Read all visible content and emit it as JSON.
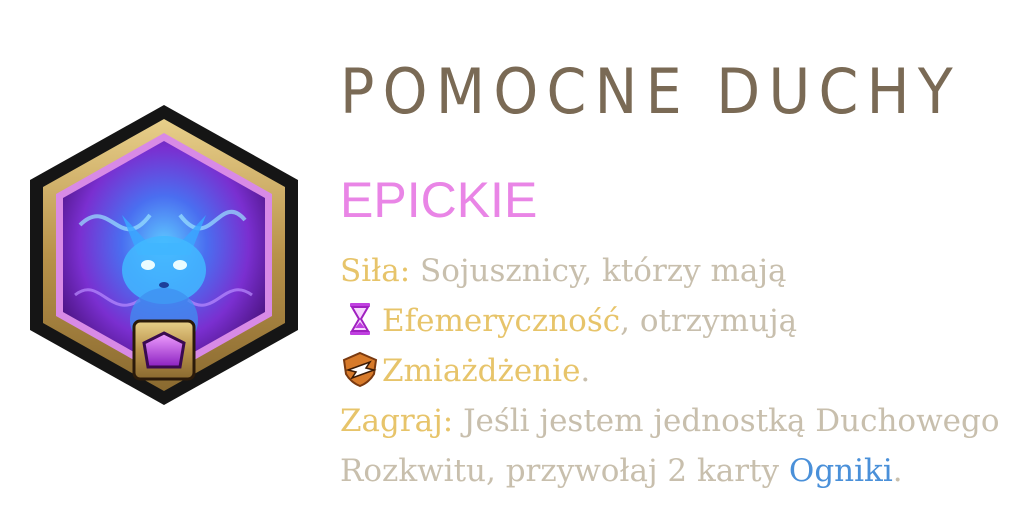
{
  "title": "POMOCNE DUCHY",
  "rarity": "EPICKIE",
  "description": {
    "line1": {
      "keyword": "Siła",
      "sep": ":",
      "text": " Sojusznicy, którzy mają"
    },
    "line2": {
      "icon": "hourglass-icon",
      "keyword": "Efemeryczność",
      "text": ", otrzymują"
    },
    "line3": {
      "icon": "overwhelm-icon",
      "keyword": "Zmiażdżenie",
      "text": "."
    },
    "line4": {
      "keyword": "Zagraj",
      "sep": ":",
      "text": " Jeśli jestem jednostką Duchowego"
    },
    "line5": {
      "text": "Rozkwitu, przywołaj 2 karty ",
      "link": "Ogniki",
      "end": "."
    }
  },
  "colors": {
    "title": "#7a6a55",
    "rarity": "#e985e6",
    "body_text": "#c8bfad",
    "keyword": "#e7c46a",
    "link": "#4a90d9",
    "hex_border_gold": "#c9a65a",
    "hex_inner": "#7a2fd0"
  },
  "icons": {
    "main": "spirit-fox-hexagon-icon",
    "gem": "purple-gem-icon"
  }
}
